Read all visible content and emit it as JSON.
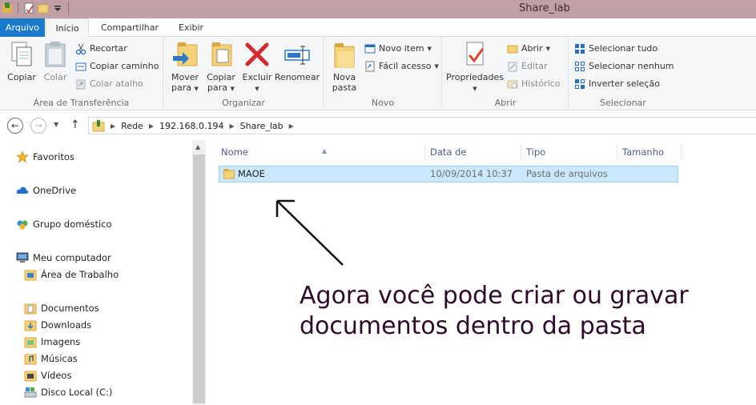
{
  "window": {
    "title": "Share_lab"
  },
  "tabs": {
    "file": "Arquivo",
    "home": "Início",
    "share": "Compartilhar",
    "view": "Exibir"
  },
  "ribbon": {
    "clipboard": {
      "label": "Área de Transferência",
      "copy": "Copiar",
      "paste": "Colar",
      "cut": "Recortar",
      "copy_path": "Copiar caminho",
      "paste_shortcut": "Colar atalho"
    },
    "organize": {
      "label": "Organizar",
      "move_to_1": "Mover",
      "move_to_2": "para",
      "copy_to_1": "Copiar",
      "copy_to_2": "para",
      "delete": "Excluir",
      "rename": "Renomear"
    },
    "new": {
      "label": "Novo",
      "new_folder_1": "Nova",
      "new_folder_2": "pasta",
      "new_item": "Novo item",
      "easy_access": "Fácil acesso"
    },
    "open": {
      "label": "Abrir",
      "properties": "Propriedades",
      "open": "Abrir",
      "edit": "Editar",
      "history": "Histórico"
    },
    "select": {
      "label": "Selecionar",
      "select_all": "Selecionar tudo",
      "select_none": "Selecionar nenhum",
      "invert": "Inverter seleção"
    }
  },
  "address": {
    "crumbs": [
      "Rede",
      "192.168.0.194",
      "Share_lab"
    ]
  },
  "navpane": {
    "favorites": "Favoritos",
    "onedrive": "OneDrive",
    "homegroup": "Grupo doméstico",
    "computer": "Meu computador",
    "desktop": "Área de Trabalho",
    "documents": "Documentos",
    "downloads": "Downloads",
    "pictures": "Imagens",
    "music": "Músicas",
    "videos": "Vídeos",
    "local_disk": "Disco Local (C:)"
  },
  "columns": {
    "name": "Nome",
    "date": "Data de modificaç...",
    "type": "Tipo",
    "size": "Tamanho"
  },
  "files": [
    {
      "name": "MAOE",
      "date": "10/09/2014 10:37",
      "type": "Pasta de arquivos",
      "size": ""
    }
  ],
  "annotation": {
    "line1": "Agora você pode criar ou gravar",
    "line2": "documentos dentro da pasta"
  },
  "colors": {
    "file_tab": "#1979ca",
    "titlebar": "#c0a0a4",
    "selection": "#cce8ff",
    "annotation": "#2e0a2a"
  }
}
